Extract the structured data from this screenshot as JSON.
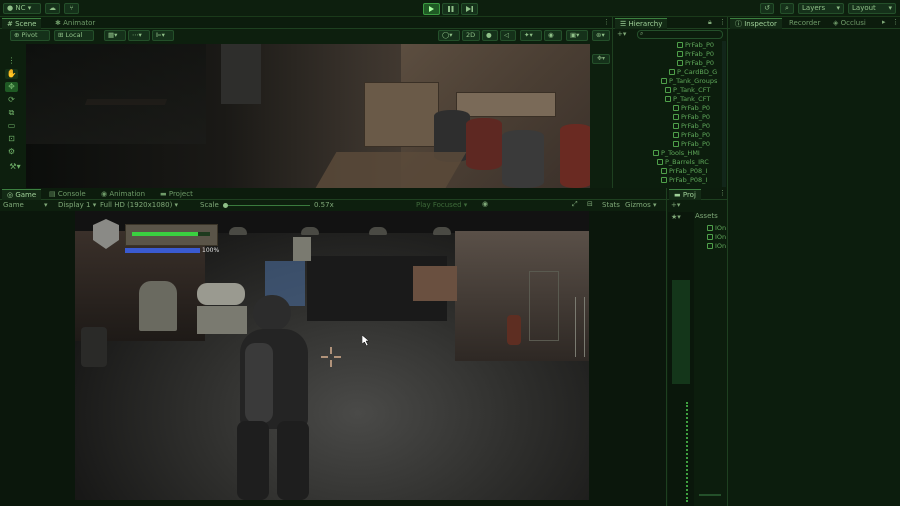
{
  "toolbar": {
    "account_label": "NC",
    "layers_label": "Layers",
    "layout_label": "Layout"
  },
  "scene_tabs": [
    {
      "label": "Scene"
    },
    {
      "label": "Animator"
    }
  ],
  "scene_toolbar": {
    "pivot_label": "Pivot",
    "local_label": "Local",
    "mode_2d_label": "2D"
  },
  "game_tabs": [
    {
      "label": "Game"
    },
    {
      "label": "Console"
    },
    {
      "label": "Animation"
    },
    {
      "label": "Project"
    }
  ],
  "game_toolbar": {
    "mode_label": "Game",
    "display_label": "Display 1",
    "resolution_label": "Full HD (1920x1080)",
    "scale_label": "Scale",
    "scale_value": "0.57x",
    "play_focused_label": "Play Focused",
    "stats_label": "Stats",
    "gizmos_label": "Gizmos"
  },
  "hud": {
    "health_percent_label": "100%",
    "health_fraction": 0.85,
    "mana_fraction": 1.0
  },
  "hierarchy": {
    "tab_label": "Hierarchy",
    "items": [
      {
        "label": "PrFab_P0"
      },
      {
        "label": "PrFab_P0"
      },
      {
        "label": "PrFab_P0"
      },
      {
        "label": "P_CardBD_G"
      },
      {
        "label": "P_Tank_Groups"
      },
      {
        "label": "P_Tank_CFT"
      },
      {
        "label": "P_Tank_CFT"
      },
      {
        "label": "PrFab_P0"
      },
      {
        "label": "PrFab_P0"
      },
      {
        "label": "PrFab_P0"
      },
      {
        "label": "PrFab_P0"
      },
      {
        "label": "PrFab_P0"
      },
      {
        "label": "P_Tools_HMI"
      },
      {
        "label": "P_Barrels_IRC"
      },
      {
        "label": "PrFab_P08_I"
      },
      {
        "label": "PrFab_P08_I"
      }
    ]
  },
  "right_tabs": [
    {
      "label": "Inspector"
    },
    {
      "label": "Recorder"
    },
    {
      "label": "Occlusi"
    }
  ],
  "project": {
    "tab_label": "Proj",
    "assets_label": "Assets",
    "files": [
      {
        "label": "IOn"
      },
      {
        "label": "IOn"
      },
      {
        "label": "IOn"
      }
    ]
  }
}
